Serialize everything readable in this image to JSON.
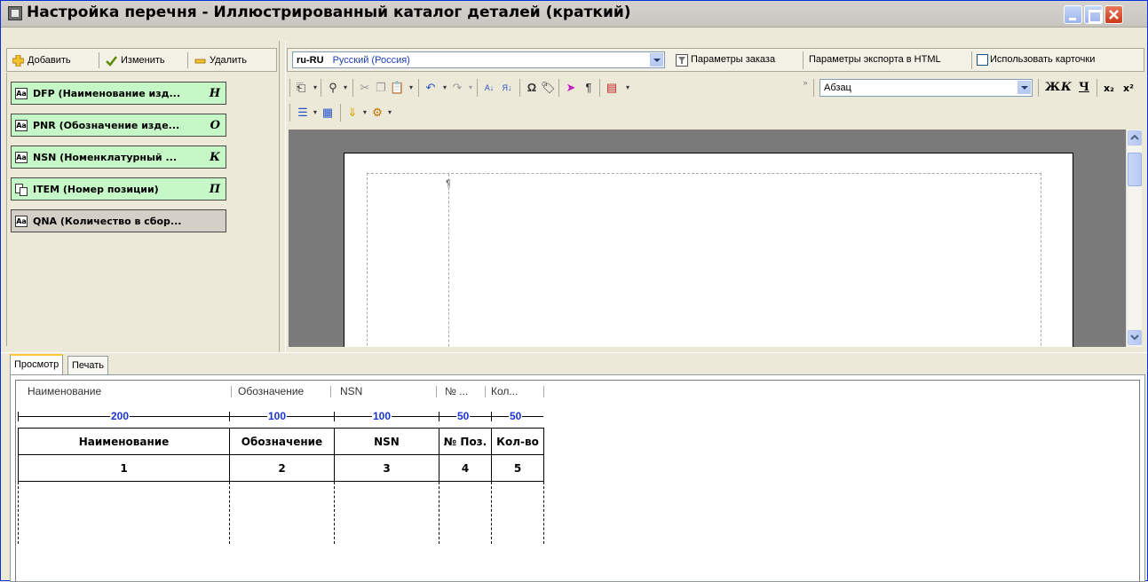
{
  "window": {
    "title": "Настройка перечня - Иллюстрированный каталог деталей (краткий)",
    "title_bar_color": "#c8c5c0",
    "close_button_color": "#c9391a"
  },
  "left_toolbar": {
    "add_label": "Добавить",
    "edit_label": "Изменить",
    "delete_label": "Удалить"
  },
  "fields": [
    {
      "label": "DFP (Наименование изд...",
      "hotkey": "Н",
      "icon": "text-field-icon",
      "active": true
    },
    {
      "label": "PNR (Обозначение изде...",
      "hotkey": "О",
      "icon": "text-field-icon",
      "active": true
    },
    {
      "label": "NSN (Номенклатурный ...",
      "hotkey": "К",
      "icon": "text-field-icon",
      "active": true
    },
    {
      "label": "ITEM (Номер позиции)",
      "hotkey": "П",
      "icon": "numbered-field-icon",
      "active": true
    },
    {
      "label": "QNA (Количество в сбор...",
      "hotkey": "",
      "icon": "text-field-icon",
      "active": false
    }
  ],
  "language_bar": {
    "code": "ru-RU",
    "name": "Русский (Россия)",
    "order_params_label": "Параметры заказа",
    "html_export_label": "Параметры экспорта в HTML",
    "use_cards_label": "Использовать карточки",
    "use_cards_checked": false
  },
  "editor": {
    "paragraph_style": "Абзац",
    "bold_label": "Ж",
    "italic_label": "К",
    "underline_label": "Ч",
    "subscript_label": "x₂",
    "superscript_label": "x²",
    "pilcrow": "¶"
  },
  "tabs": [
    {
      "label": "Просмотр",
      "active": true
    },
    {
      "label": "Печать",
      "active": false
    }
  ],
  "preview": {
    "header_columns": [
      "Наименование",
      "Обозначение",
      "NSN",
      "№ ...",
      "Кол..."
    ],
    "widths": [
      "200",
      "100",
      "100",
      "50",
      "50"
    ],
    "table_headers": [
      "Наименование",
      "Обозначение",
      "NSN",
      "№ Поз.",
      "Кол-во"
    ],
    "table_numbers": [
      "1",
      "2",
      "3",
      "4",
      "5"
    ]
  }
}
